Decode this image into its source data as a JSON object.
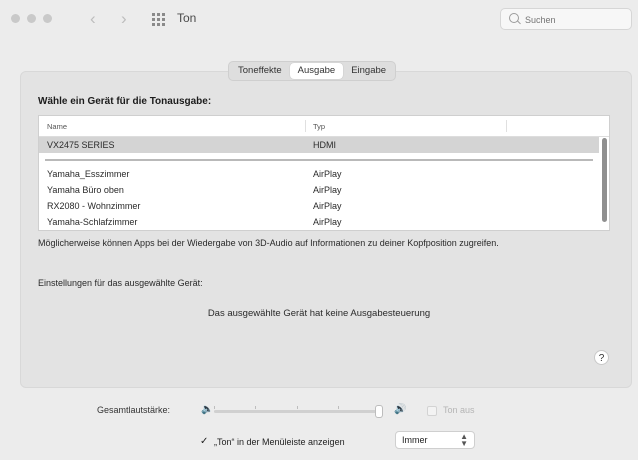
{
  "window": {
    "title": "Ton"
  },
  "search": {
    "placeholder": "Suchen"
  },
  "tabs": [
    "Toneffekte",
    "Ausgabe",
    "Eingabe"
  ],
  "active_tab": "Ausgabe",
  "output": {
    "heading": "Wähle ein Gerät für die Tonausgabe:",
    "columns": [
      "Name",
      "Typ"
    ],
    "devices": [
      {
        "name": "VX2475 SERIES",
        "type": "HDMI",
        "selected": true
      },
      {
        "name": "Yamaha_Esszimmer",
        "type": "AirPlay"
      },
      {
        "name": "Yamaha Büro oben",
        "type": "AirPlay"
      },
      {
        "name": "RX2080 - Wohnzimmer",
        "type": "AirPlay"
      },
      {
        "name": "Yamaha-Schlafzimmer",
        "type": "AirPlay"
      }
    ],
    "note": "Möglicherweise können Apps bei der Wiedergabe von 3D-Audio auf Informationen zu deiner Kopfposition zugreifen.",
    "settings_label": "Einstellungen für das ausgewählte Gerät:",
    "no_control": "Das ausgewählte Gerät hat keine Ausgabesteuerung"
  },
  "help": {
    "label": "?"
  },
  "volume": {
    "label": "Gesamtlautstärke:",
    "level": 1.0,
    "mute_label": "Ton aus",
    "muted": false
  },
  "menubar": {
    "checked": true,
    "check_glyph": "✓",
    "label": "„Ton“ in der Menüleiste anzeigen",
    "option": "Immer"
  },
  "icons": {
    "nav_back": "chevron-left-icon",
    "nav_forward": "chevron-right-icon",
    "all_prefs": "grid-icon",
    "search": "magnifier-icon",
    "speaker_low": "speaker-low-icon",
    "speaker_high": "speaker-high-icon"
  },
  "colors": {
    "selection": "#d4d4d4",
    "panel": "#e3e3e3",
    "window": "#ececec"
  }
}
